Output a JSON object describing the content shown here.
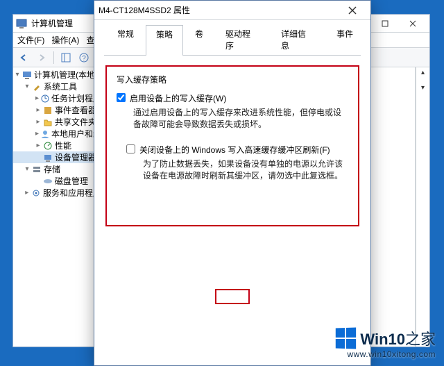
{
  "mgmt": {
    "title": "计算机管理",
    "menu": {
      "file": "文件(F)",
      "action": "操作(A)",
      "view": "查"
    },
    "tree": {
      "root": "计算机管理(本地)",
      "system_tools": "系统工具",
      "task_scheduler": "任务计划程序",
      "event_viewer": "事件查看器",
      "shared_folders": "共享文件夹",
      "local_users": "本地用户和组",
      "performance": "性能",
      "device_manager": "设备管理器",
      "storage": "存储",
      "disk_mgmt": "磁盘管理",
      "services": "服务和应用程序"
    }
  },
  "props": {
    "title": "M4-CT128M4SSD2 属性",
    "tabs": {
      "general": "常规",
      "policies": "策略",
      "volumes": "卷",
      "driver": "驱动程序",
      "details": "详细信息",
      "events": "事件"
    },
    "policy": {
      "legend": "写入缓存策略",
      "enable_label": "启用设备上的写入缓存(W)",
      "enable_desc": "通过启用设备上的写入缓存来改进系统性能，但停电或设备故障可能会导致数据丢失或损坏。",
      "flush_label": "关闭设备上的 Windows 写入高速缓存缓冲区刷新(F)",
      "flush_desc": "为了防止数据丢失，如果设备没有单独的电源以允许该设备在电源故障时刷新其缓冲区，请勿选中此复选框。"
    }
  },
  "watermark": {
    "brand_a": "Win10",
    "brand_b": "之家",
    "url": "www.win10xitong.com"
  }
}
